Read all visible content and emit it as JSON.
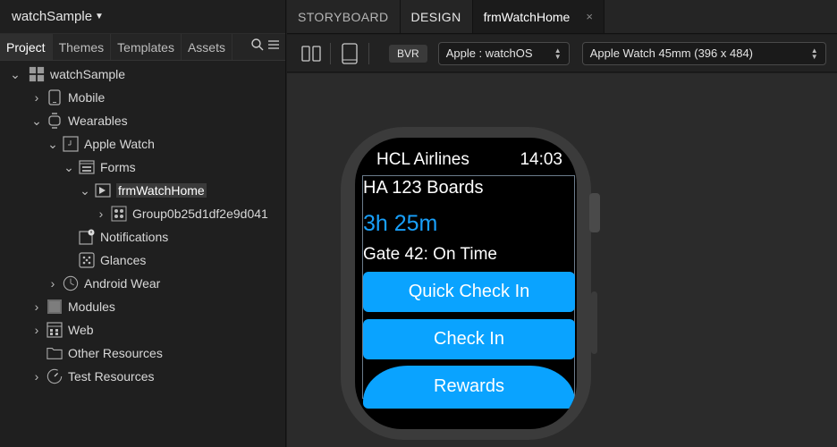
{
  "project": {
    "name": "watchSample"
  },
  "left_tabs": [
    "Project",
    "Themes",
    "Templates",
    "Assets"
  ],
  "tree": {
    "root": "watchSample",
    "mobile": "Mobile",
    "wearables": "Wearables",
    "apple_watch": "Apple Watch",
    "forms": "Forms",
    "form": "frmWatchHome",
    "group": "Group0b25d1df2e9d041",
    "notifications": "Notifications",
    "glances": "Glances",
    "android_wear": "Android Wear",
    "modules": "Modules",
    "web": "Web",
    "other_resources": "Other Resources",
    "test_resources": "Test Resources"
  },
  "top_tabs": {
    "storyboard": "STORYBOARD",
    "design": "DESIGN",
    "form": "frmWatchHome",
    "close": "×"
  },
  "toolbar": {
    "bvr": "BVR",
    "platform": "Apple : watchOS",
    "device": "Apple Watch 45mm (396 x 484)"
  },
  "watch": {
    "title": "HCL Airlines",
    "time": "14:03",
    "boarding": "HA 123 Boards",
    "eta": "3h 25m",
    "gate": "Gate 42: On Time",
    "buttons": [
      "Quick Check In",
      "Check In",
      "Rewards"
    ]
  },
  "colors": {
    "accent": "#0aa3ff",
    "eta_text": "#18a0fb"
  }
}
